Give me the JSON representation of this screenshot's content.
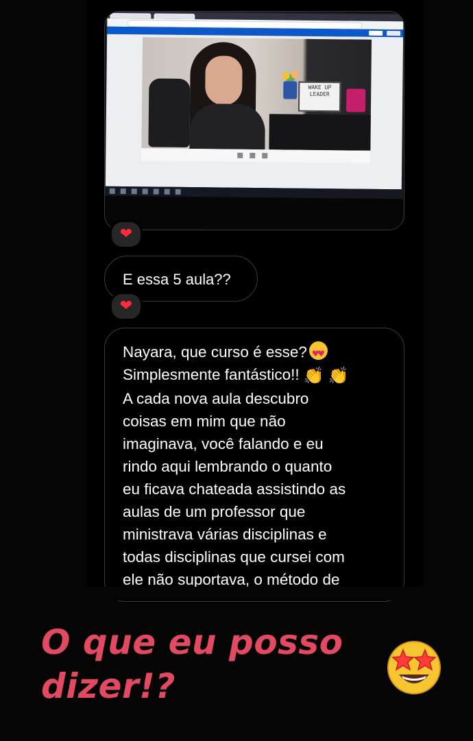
{
  "messages": {
    "short_text": "E essa 5 aula??",
    "long_lines": [
      "Nayara, que curso é esse?",
      "Simplesmente fantástico!!",
      "A cada nova aula descubro",
      "coisas em mim que não",
      "imaginava, você falando e eu",
      "rindo aqui lembrando o quanto",
      "eu ficava chateada assistindo as",
      "aulas de um professor que",
      "ministrava várias disciplinas e",
      "todas disciplinas que cursei com",
      "ele não suportava, o método de"
    ]
  },
  "reactions": {
    "photo_reaction": "❤",
    "short_reaction": "❤"
  },
  "photo": {
    "lightbox_text": "WAKE UP LEADER"
  },
  "caption": {
    "line1": "O que eu posso",
    "line2": "dizer!?"
  },
  "icons": {
    "heart_eyes": "smiling-face-with-heart-eyes-icon",
    "clap": "clapping-hands-icon",
    "star_struck": "star-struck-icon"
  },
  "colors": {
    "caption": "#e24a61",
    "heart": "#ff2a3b",
    "background": "#050505"
  }
}
